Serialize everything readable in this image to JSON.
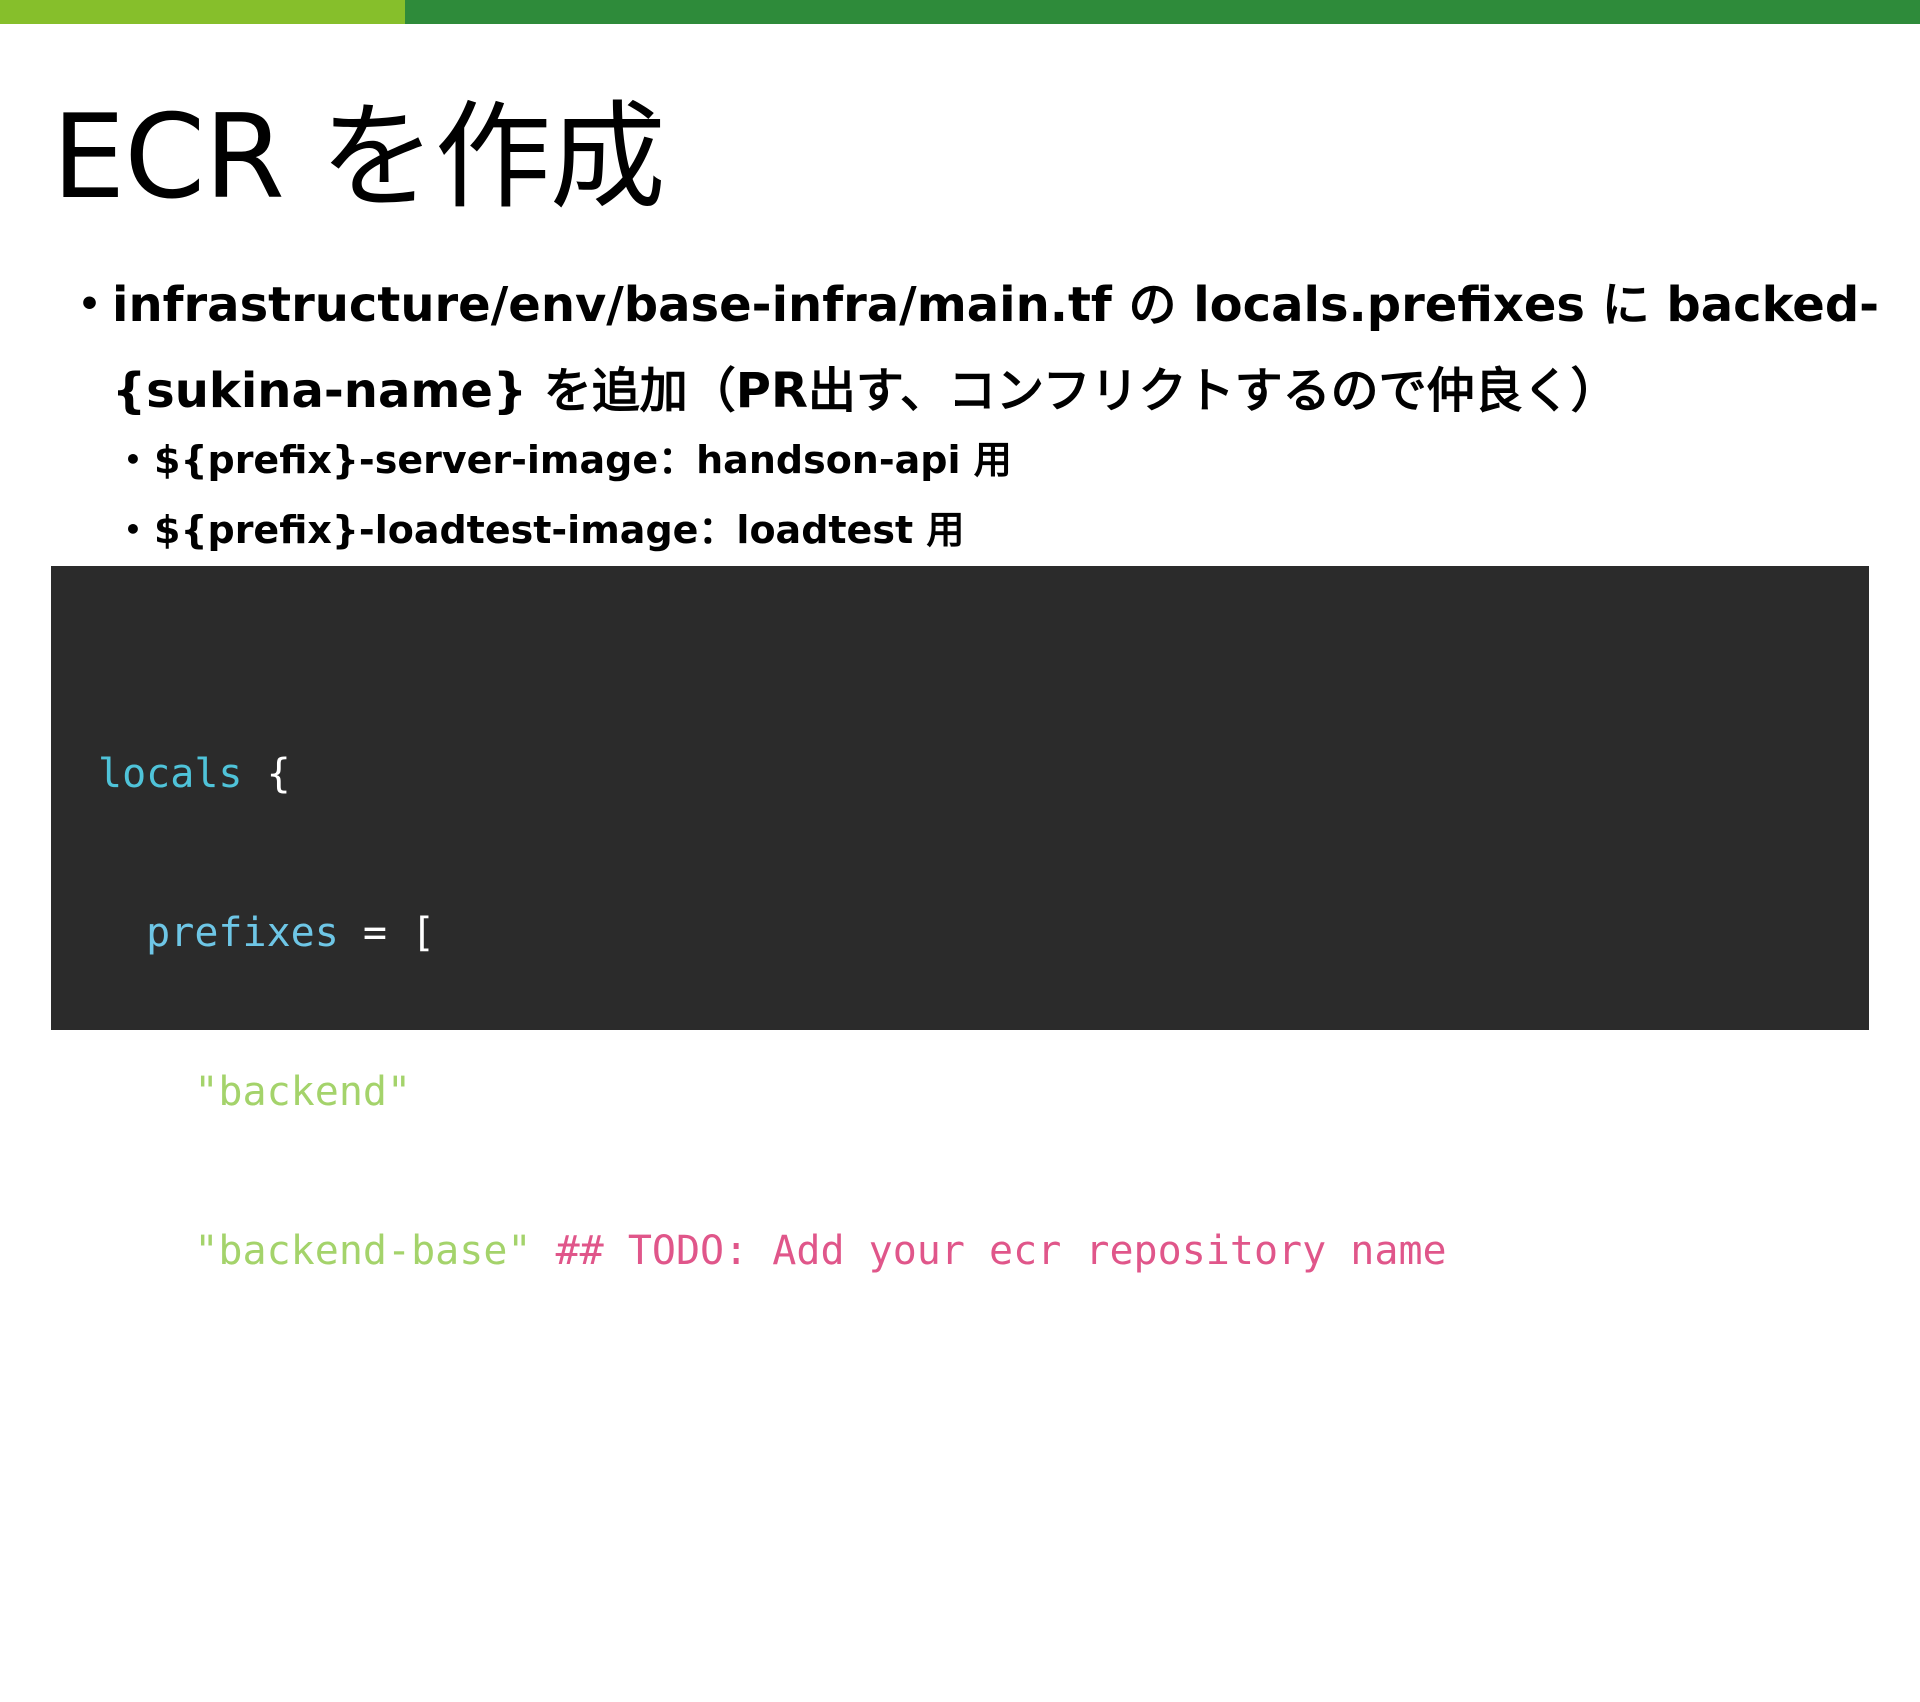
{
  "colors": {
    "topbar_light": "#86bf2b",
    "topbar_dark": "#2e8b3a",
    "code_bg": "#2b2b2b"
  },
  "slide": {
    "title": "ECR を作成",
    "bullet_1": {
      "line_1": "infrastructure/env/base-infra/main.tf の locals.prefixes に backed-",
      "line_2": "{sukina-name} を追加（PR出す、コンフリクトするので仲良く）"
    },
    "sub_bullets": [
      "${prefix}-server-image：handson-api 用",
      "${prefix}-loadtest-image：loadtest 用"
    ],
    "bullet_marker": "•"
  },
  "code": {
    "line_1": {
      "kw": "locals",
      "punc": " {"
    },
    "line_2": {
      "indent": "  ",
      "attr": "prefixes",
      "punc": " = ["
    },
    "line_3": {
      "indent": "    ",
      "str": "\"backend\"",
      "punc": ","
    },
    "line_4": {
      "indent": "    ",
      "str": "\"backend-base\"",
      "cmt": " ## TODO: Add your ecr repository name"
    },
    "line_5": {
      "indent": "  ",
      "punc": "]"
    },
    "line_6": {
      "punc": "}"
    }
  }
}
